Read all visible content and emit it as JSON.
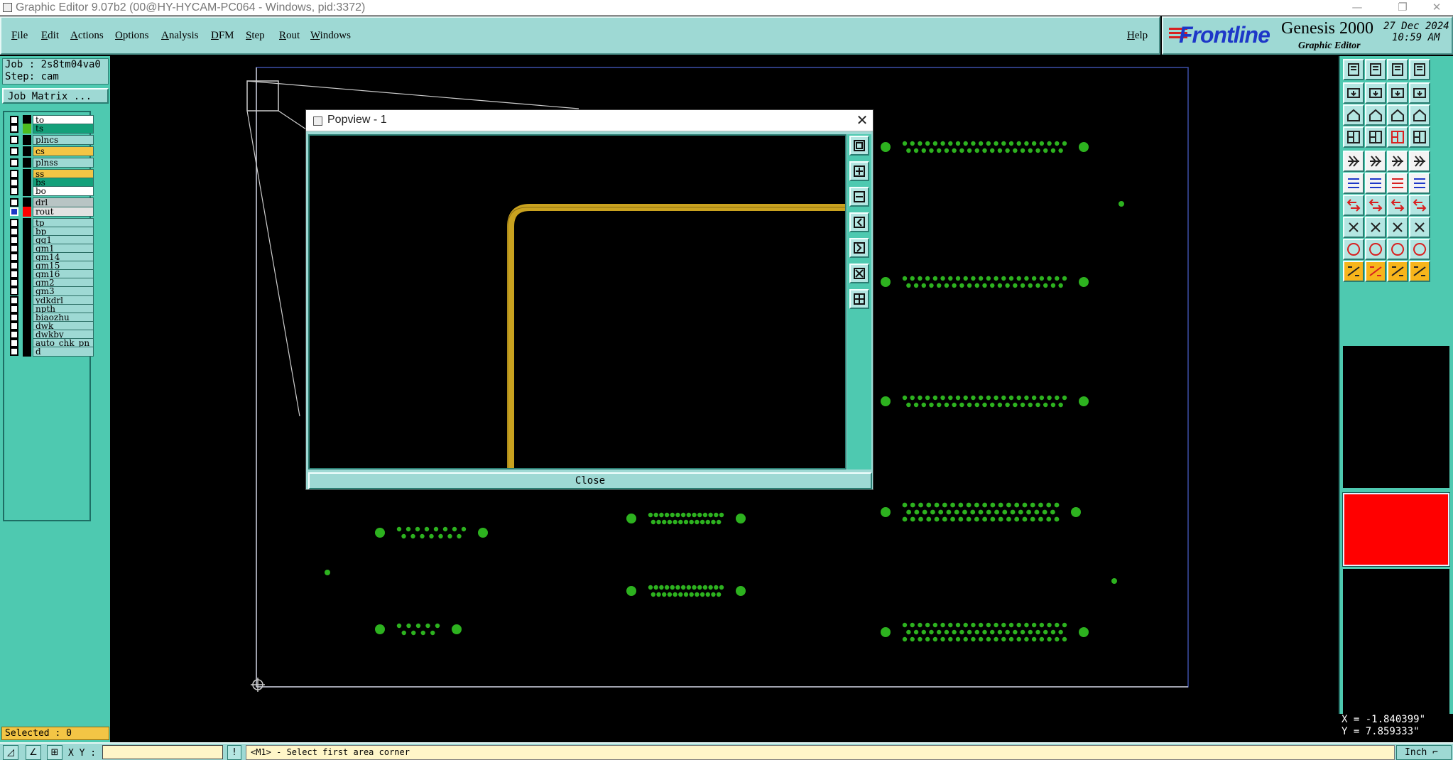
{
  "window": {
    "title": "Graphic Editor 9.07b2 (00@HY-HYCAM-PC064 - Windows, pid:3372)",
    "controls": {
      "minimize": "—",
      "restore": "❐",
      "close": "✕"
    }
  },
  "menubar": {
    "items": [
      {
        "u": "F",
        "rest": "ile"
      },
      {
        "u": "E",
        "rest": "dit"
      },
      {
        "u": "A",
        "rest": "ctions"
      },
      {
        "u": "O",
        "rest": "ptions"
      },
      {
        "u": "A",
        "rest": "nalysis"
      },
      {
        "u": "D",
        "rest": "FM"
      },
      {
        "u": "S",
        "rest": "tep"
      },
      {
        "u": "R",
        "rest": "out"
      },
      {
        "u": "W",
        "rest": "indows"
      }
    ],
    "help": {
      "u": "H",
      "rest": "elp"
    }
  },
  "brand": {
    "logo": "Frontline",
    "product": "Genesis 2000",
    "subtitle": "Graphic Editor",
    "date": "27 Dec 2024",
    "time": "10:59 AM"
  },
  "leftpanel": {
    "job": "Job : 2s8tm04va0",
    "step": "Step: cam",
    "job_matrix": "Job Matrix ...",
    "layers": [
      {
        "name": "to",
        "color": "#ffffff"
      },
      {
        "name": "ts",
        "color": "#14a07a",
        "swatch": "#4dbd1f"
      },
      {
        "name": "plncs",
        "color": "#9ed9d4"
      },
      {
        "name": "cs",
        "color": "#f3c545"
      },
      {
        "name": "plnss",
        "color": "#9ed9d4"
      },
      {
        "name": "ss",
        "color": "#f3c545"
      },
      {
        "name": "bs",
        "color": "#14a07a"
      },
      {
        "name": "bo",
        "color": "#ffffff"
      },
      {
        "name": "drl",
        "color": "#b8c4c4"
      },
      {
        "name": "rout",
        "color": "#e2e2e2",
        "swatch": "#ff0000",
        "checked": true
      },
      {
        "name": "tp",
        "color": "#9ed9d4"
      },
      {
        "name": "bp",
        "color": "#9ed9d4"
      },
      {
        "name": "gg1",
        "color": "#9ed9d4"
      },
      {
        "name": "gm1",
        "color": "#9ed9d4"
      },
      {
        "name": "gm14",
        "color": "#9ed9d4"
      },
      {
        "name": "gm15",
        "color": "#9ed9d4"
      },
      {
        "name": "gm16",
        "color": "#9ed9d4"
      },
      {
        "name": "gm2",
        "color": "#9ed9d4"
      },
      {
        "name": "gm3",
        "color": "#9ed9d4"
      },
      {
        "name": "ydkdrl",
        "color": "#9ed9d4"
      },
      {
        "name": "npth",
        "color": "#9ed9d4"
      },
      {
        "name": "biaozhu",
        "color": "#9ed9d4"
      },
      {
        "name": "dwk",
        "color": "#9ed9d4"
      },
      {
        "name": "dwkby",
        "color": "#9ed9d4"
      },
      {
        "name": "auto_chk_pn",
        "color": "#9ed9d4"
      },
      {
        "name": "d",
        "color": "#9ed9d4"
      }
    ],
    "selected": "Selected : 0"
  },
  "popview": {
    "title": "Popview - 1",
    "close_x": "✕",
    "close_button": "Close"
  },
  "bottombar": {
    "xy_label": "X Y :",
    "xy_value": "",
    "exclaim": "!",
    "status": "<M1> - Select first area corner",
    "units": "Inch"
  },
  "coords": {
    "x": "X = -1.840399\"",
    "y": "Y = 7.859333\""
  },
  "colors": {
    "panel": "#4ec9b0",
    "menubar": "#9ed9d4",
    "pad": "#2db21f",
    "trace": "#c9a21f",
    "board_outline": "#3c4fa8",
    "active_layer": "#ff0000"
  }
}
